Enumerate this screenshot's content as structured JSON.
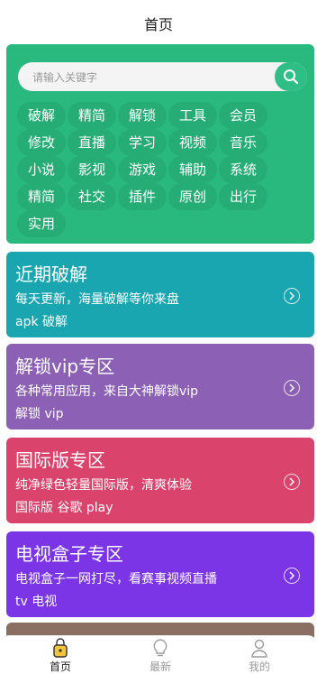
{
  "header": {
    "title": "首页"
  },
  "search": {
    "placeholder": "请输入关键字"
  },
  "tags": [
    "破解",
    "精简",
    "解锁",
    "工具",
    "会员",
    "修改",
    "直播",
    "学习",
    "视频",
    "音乐",
    "小说",
    "影视",
    "游戏",
    "辅助",
    "系统",
    "精简",
    "社交",
    "插件",
    "原创",
    "出行",
    "实用"
  ],
  "cards": [
    {
      "title": "近期破解",
      "desc": "每天更新，海量破解等你来盘",
      "sub": "apk 破解",
      "color": "#1aa6b0"
    },
    {
      "title": "解锁vip专区",
      "desc": "各种常用应用，来自大神解锁vip",
      "sub": "解锁 vip",
      "color": "#8c61b5"
    },
    {
      "title": "国际版专区",
      "desc": "纯净绿色轻量国际版，清爽体验",
      "sub": "国际版 谷歌 play",
      "color": "#d9436c"
    },
    {
      "title": "电视盒子专区",
      "desc": "电视盒子一网打尽，看赛事视频直播",
      "sub": "tv 电视",
      "color": "#7b35e6"
    }
  ],
  "tabs": [
    {
      "label": "首页",
      "icon": "home-icon",
      "active": true
    },
    {
      "label": "最新",
      "icon": "lightbulb-icon",
      "active": false
    },
    {
      "label": "我的",
      "icon": "user-icon",
      "active": false
    }
  ]
}
